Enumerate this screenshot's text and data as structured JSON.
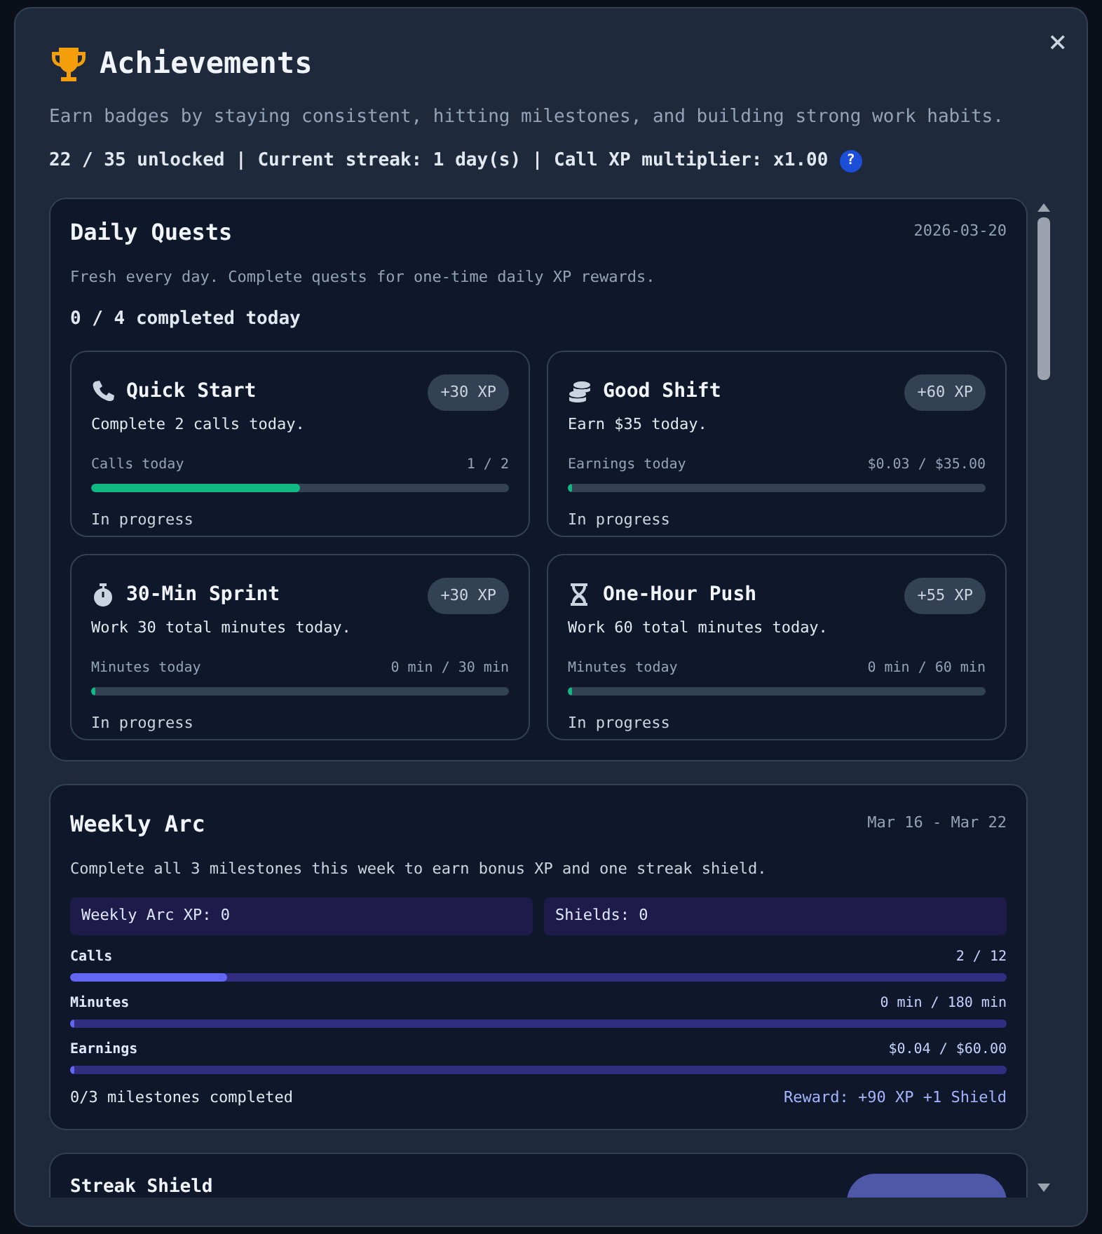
{
  "modal": {
    "title": "Achievements",
    "subtitle": "Earn badges by staying consistent, hitting milestones, and building strong work habits.",
    "summary": "22 / 35 unlocked | Current streak: 1 day(s) | Call XP multiplier: x1.00",
    "help_icon": "?",
    "close_icon": "×"
  },
  "daily_quests": {
    "title": "Daily Quests",
    "date": "2026-03-20",
    "description": "Fresh every day. Complete quests for one-time daily XP rewards.",
    "completed": "0 / 4 completed today",
    "quests": [
      {
        "kind": "phone",
        "title": "Quick Start",
        "reward": "+30 XP",
        "description": "Complete 2 calls today.",
        "metric_label": "Calls today",
        "metric_value": "1 / 2",
        "level": 0.5,
        "status": "In progress"
      },
      {
        "kind": "coins",
        "title": "Good Shift",
        "reward": "+60 XP",
        "description": "Earn $35 today.",
        "metric_label": "Earnings today",
        "metric_value": "$0.03 / $35.00",
        "level": 0.001,
        "status": "In progress"
      },
      {
        "kind": "stopwatch",
        "title": "30-Min Sprint",
        "reward": "+30 XP",
        "description": "Work 30 total minutes today.",
        "metric_label": "Minutes today",
        "metric_value": "0 min / 30 min",
        "level": 0,
        "status": "In progress"
      },
      {
        "kind": "hourglass",
        "title": "One-Hour Push",
        "reward": "+55 XP",
        "description": "Work 60 total minutes today.",
        "metric_label": "Minutes today",
        "metric_value": "0 min / 60 min",
        "level": 0,
        "status": "In progress"
      }
    ]
  },
  "weekly_arc": {
    "title": "Weekly Arc",
    "dates": "Mar 16 - Mar 22",
    "description": "Complete all 3 milestones this week to earn bonus XP and one streak shield.",
    "stats": [
      "Weekly Arc XP: 0",
      "Shields: 0"
    ],
    "milestones": [
      {
        "label": "Calls",
        "value": "2 / 12",
        "level": 0.167
      },
      {
        "label": "Minutes",
        "value": "0 min / 180 min",
        "level": 0
      },
      {
        "label": "Earnings",
        "value": "$0.04 / $60.00",
        "level": 0.001
      }
    ],
    "footer": "0/3 milestones completed",
    "reward": "Reward: +90 XP +1 Shield"
  },
  "streak_shield": {
    "title": "Streak Shield"
  }
}
